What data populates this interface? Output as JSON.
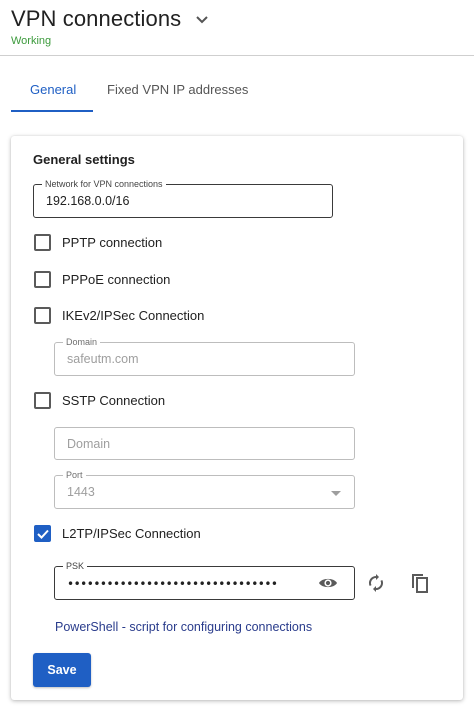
{
  "header": {
    "title": "VPN connections",
    "status": "Working",
    "status_color": "#3c9a3c",
    "dropdown_icon": "chevron-down-icon"
  },
  "tabs": [
    {
      "label": "General",
      "active": true
    },
    {
      "label": "Fixed VPN IP addresses",
      "active": false
    }
  ],
  "settings": {
    "section_title": "General settings",
    "network": {
      "label": "Network for VPN connections",
      "value": "192.168.0.0/16"
    },
    "pptp": {
      "label": "PPTP connection",
      "checked": false
    },
    "pppoe": {
      "label": "PPPoE connection",
      "checked": false
    },
    "ikev2": {
      "label": "IKEv2/IPSec Connection",
      "checked": false,
      "domain_label": "Domain",
      "domain_value": "safeutm.com"
    },
    "sstp": {
      "label": "SSTP Connection",
      "checked": false,
      "domain_placeholder": "Domain",
      "port_label": "Port",
      "port_value": "1443"
    },
    "l2tp": {
      "label": "L2TP/IPSec Connection",
      "checked": true,
      "psk_label": "PSK",
      "psk_value": "••••••••••••••••••••••••••••••••"
    },
    "script_link": "PowerShell - script for configuring connections",
    "save_label": "Save"
  },
  "colors": {
    "accent": "#1f5fc4",
    "link": "#2a3c8c"
  },
  "icons": [
    "chevron-down-icon",
    "check-icon",
    "eye-icon",
    "refresh-icon",
    "copy-icon",
    "caret-down-icon"
  ]
}
